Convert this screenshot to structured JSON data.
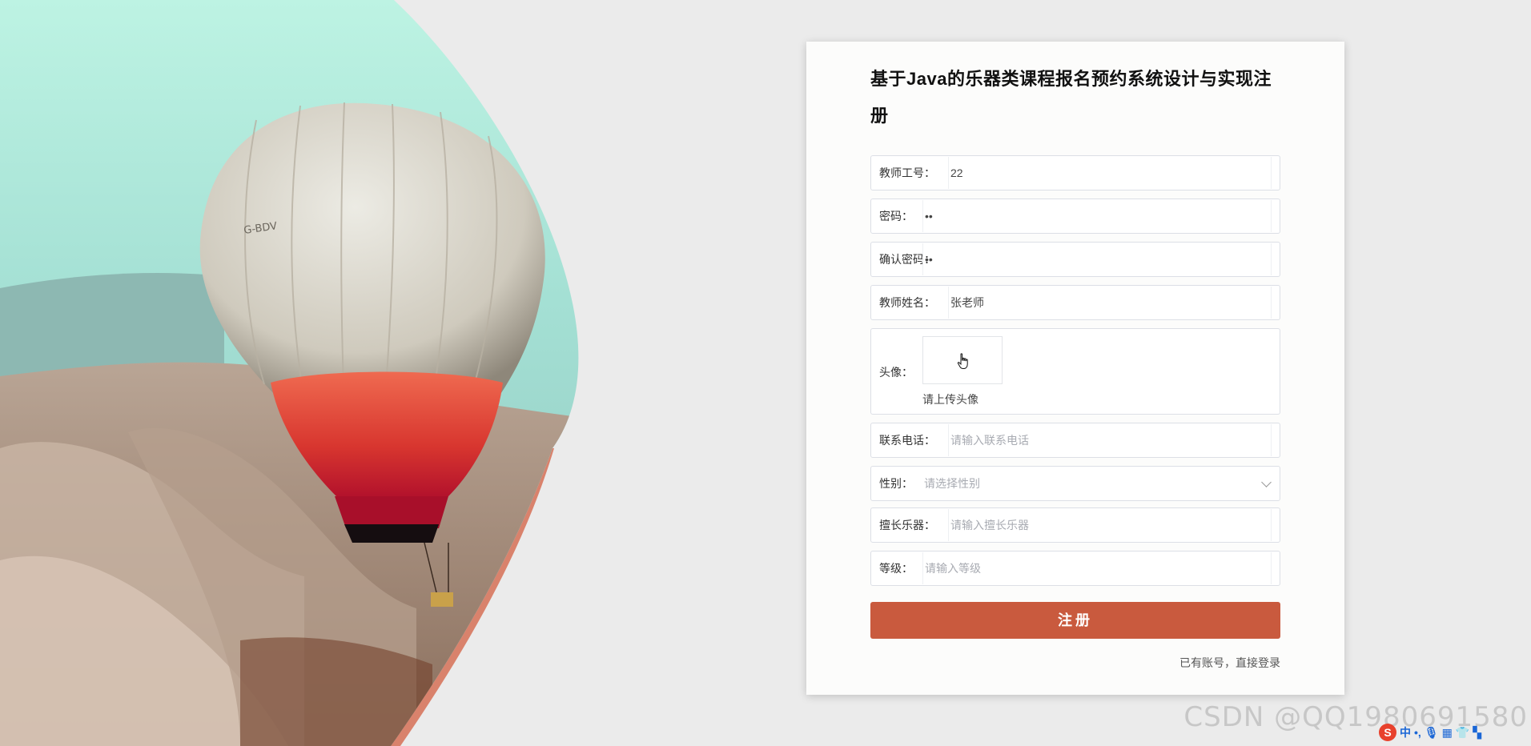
{
  "form": {
    "title": "基于Java的乐器类课程报名预约系统设计与实现注册",
    "fields": [
      {
        "label": "教师工号：",
        "value": "22",
        "placeholder": ""
      },
      {
        "label": "密码：",
        "value": "••",
        "placeholder": ""
      },
      {
        "label": "确认密码：",
        "value": "••",
        "placeholder": ""
      },
      {
        "label": "教师姓名：",
        "value": "张老师",
        "placeholder": ""
      },
      {
        "label": "联系电话：",
        "value": "",
        "placeholder": "请输入联系电话"
      },
      {
        "label": "性别：",
        "value": "",
        "placeholder": "请选择性别"
      },
      {
        "label": "擅长乐器：",
        "value": "",
        "placeholder": "请输入擅长乐器"
      },
      {
        "label": "等级：",
        "value": "",
        "placeholder": "请输入等级"
      }
    ],
    "avatar": {
      "label": "头像：",
      "hint": "请上传头像"
    },
    "submit_label": "注册",
    "login_link": "已有账号，直接登录"
  },
  "watermark": "CSDN @QQ1980691580",
  "ime": {
    "logo": "S",
    "mode": "中"
  },
  "colors": {
    "accent": "#c95a3e",
    "background": "#ebebeb",
    "card": "#fcfcfb"
  },
  "hero": {
    "balloon_marking": "G-BDV"
  }
}
